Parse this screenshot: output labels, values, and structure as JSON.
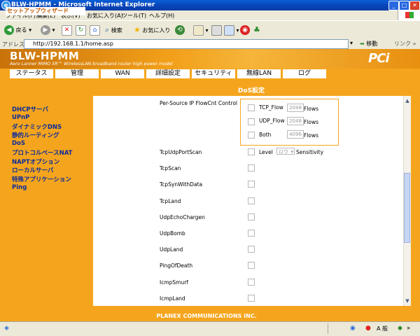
{
  "window": {
    "title": "BLW-HPMM - Microsoft Internet Explorer"
  },
  "menu": [
    "ファイル(F)",
    "編集(E)",
    "表示(V)",
    "お気に入り(A)",
    "ツール(T)",
    "ヘルプ(H)"
  ],
  "toolbar": {
    "back": "戻る",
    "search": "検索",
    "favorites": "お気に入り"
  },
  "address": {
    "label": "アドレス(D)",
    "url": "http://192.168.1.1/home.asp",
    "go": "移動",
    "links": "リンク"
  },
  "banner": {
    "title": "BLW-HPMM",
    "subtitle": "Aero Lanner MIMO XR™ WirelessLAN broadband router high power model",
    "logo": "PCi"
  },
  "nav": [
    "ステータス",
    "管理",
    "WAN",
    "詳細設定",
    "セキュリティ",
    "無線LAN",
    "ログ"
  ],
  "sidebar": {
    "heading": "セットアップウィザード",
    "items": [
      "DHCPサーバ",
      "UPnP",
      "ダイナミックDNS",
      "静的ルーティング",
      "DoS",
      "プロトコルベースNAT",
      "NAPTオプション",
      "ローカルサーバ",
      "特殊アプリケーション",
      "Ping"
    ]
  },
  "main": {
    "title": "DoS設定",
    "flow_label": "Per-Source IP FlowCnt Control",
    "flows": [
      {
        "name": "TCP_Flow",
        "value": "2048",
        "unit": "Flows"
      },
      {
        "name": "UDP_Flow",
        "value": "2048",
        "unit": "Flows"
      },
      {
        "name": "Both",
        "value": "4096",
        "unit": "Flows"
      }
    ],
    "portscan": {
      "label": "TcpUdpPortScan",
      "level_label": "Level",
      "level_value": "ロウ",
      "sensitivity": "Sensitivity"
    },
    "items": [
      "TcpScan",
      "TcpSynWithData",
      "TcpLand",
      "UdpEchoChargen",
      "UdpBomb",
      "UdpLand",
      "PingOfDeath",
      "IcmpSmurf",
      "IcmpLand"
    ]
  },
  "footer": "PLANEX COMMUNICATIONS INC.",
  "status": {
    "ime": "A 般"
  }
}
